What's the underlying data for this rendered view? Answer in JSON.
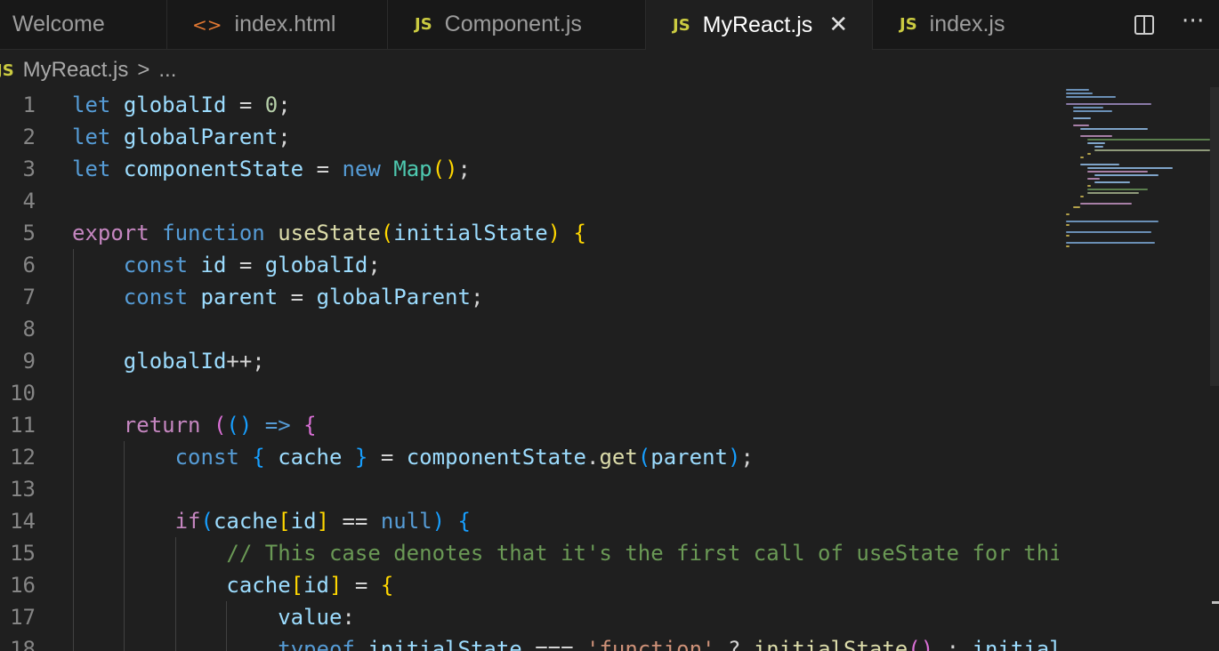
{
  "tabs": [
    {
      "label": "Welcome",
      "icon": "",
      "active": false
    },
    {
      "label": "index.html",
      "icon": "<>",
      "active": false
    },
    {
      "label": "Component.js",
      "icon": "JS",
      "active": false
    },
    {
      "label": "MyReact.js",
      "icon": "JS",
      "active": true,
      "close": "✕"
    },
    {
      "label": "index.js",
      "icon": "JS",
      "active": false
    }
  ],
  "tab_actions": {
    "more": "⋯"
  },
  "breadcrumb": {
    "icon": "JS",
    "file": "MyReact.js",
    "separator": ">",
    "rest": "..."
  },
  "editor": {
    "line_numbers": [
      "1",
      "2",
      "3",
      "4",
      "5",
      "6",
      "7",
      "8",
      "9",
      "10",
      "11",
      "12",
      "13",
      "14",
      "15",
      "16",
      "17",
      "18"
    ]
  },
  "colors": {
    "keyword": "#569cd6",
    "control": "#c586c0",
    "variable": "#9cdcfe",
    "function": "#dcdcaa",
    "type": "#4ec9b0",
    "number": "#b5cea8",
    "string": "#ce9178",
    "comment": "#6a9955",
    "js_icon": "#cbcb41"
  }
}
